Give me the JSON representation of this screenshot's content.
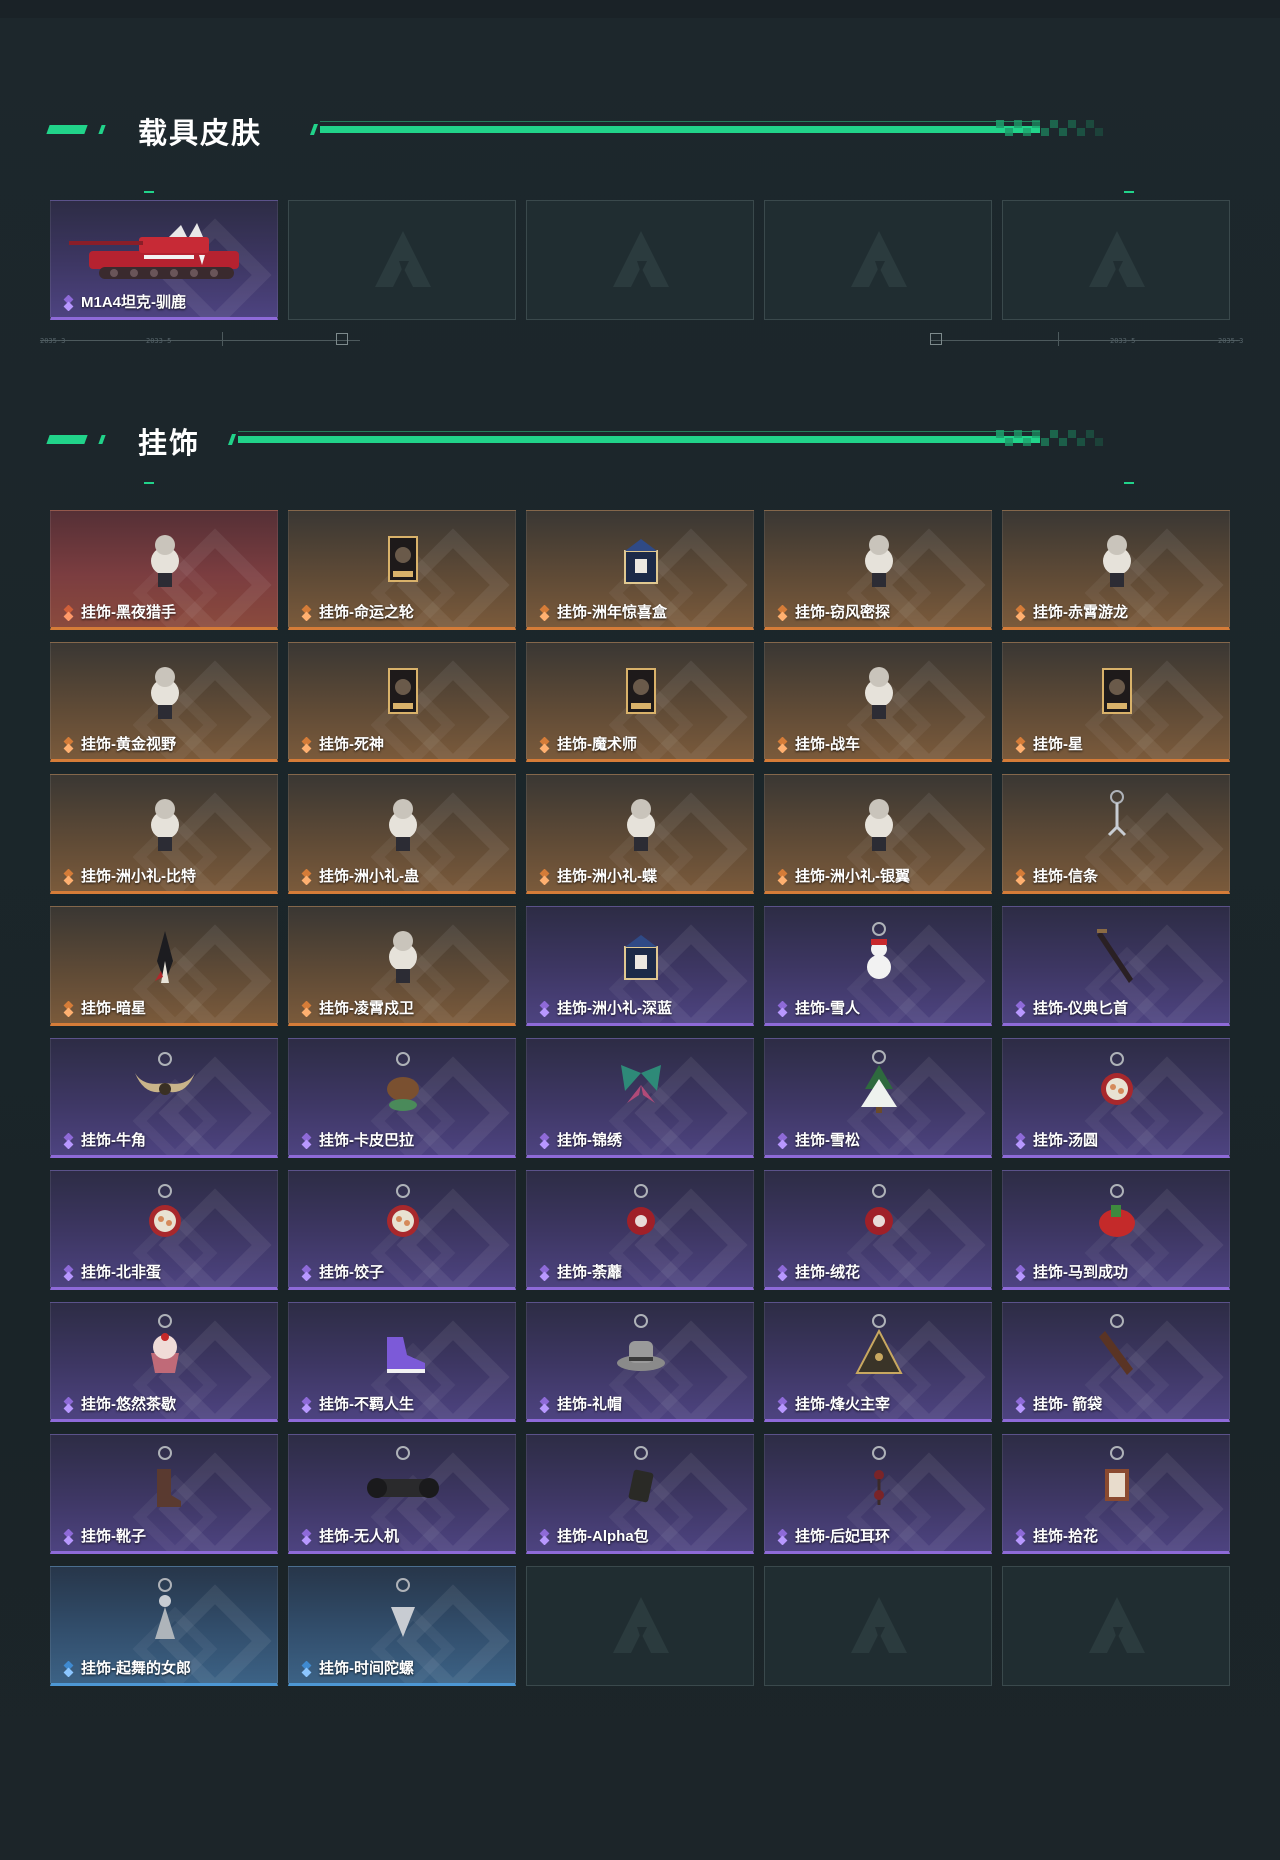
{
  "sections": {
    "vehicle_skins": {
      "title": "载具皮肤"
    },
    "pendants": {
      "title": "挂饰"
    }
  },
  "deco_labels": [
    "2035-3",
    "2033-5",
    "2033-5",
    "2035-3"
  ],
  "vehicle_cards": [
    {
      "label": "M1A4坦克-驯鹿",
      "rarity": "purple",
      "icon": "tank-icon"
    },
    {
      "label": "",
      "rarity": "empty",
      "icon": "placeholder-logo-icon"
    },
    {
      "label": "",
      "rarity": "empty",
      "icon": "placeholder-logo-icon"
    },
    {
      "label": "",
      "rarity": "empty",
      "icon": "placeholder-logo-icon"
    },
    {
      "label": "",
      "rarity": "empty",
      "icon": "placeholder-logo-icon"
    }
  ],
  "pendant_cards": [
    {
      "label": "挂饰-黑夜猎手",
      "rarity": "red",
      "icon": "pendant-figure-icon"
    },
    {
      "label": "挂饰-命运之轮",
      "rarity": "orange",
      "icon": "pendant-card-icon"
    },
    {
      "label": "挂饰-洲年惊喜盒",
      "rarity": "orange",
      "icon": "pendant-box-icon"
    },
    {
      "label": "挂饰-窃风密探",
      "rarity": "orange",
      "icon": "pendant-figure-icon"
    },
    {
      "label": "挂饰-赤霄游龙",
      "rarity": "orange",
      "icon": "pendant-figure-icon"
    },
    {
      "label": "挂饰-黄金视野",
      "rarity": "orange",
      "icon": "pendant-figure-icon"
    },
    {
      "label": "挂饰-死神",
      "rarity": "orange",
      "icon": "pendant-card-icon"
    },
    {
      "label": "挂饰-魔术师",
      "rarity": "orange",
      "icon": "pendant-card-icon"
    },
    {
      "label": "挂饰-战车",
      "rarity": "orange",
      "icon": "pendant-figure-icon"
    },
    {
      "label": "挂饰-星",
      "rarity": "orange",
      "icon": "pendant-card-icon"
    },
    {
      "label": "挂饰-洲小礼-比特",
      "rarity": "orange",
      "icon": "pendant-figure-icon"
    },
    {
      "label": "挂饰-洲小礼-蛊",
      "rarity": "orange",
      "icon": "pendant-figure-icon"
    },
    {
      "label": "挂饰-洲小礼-蝶",
      "rarity": "orange",
      "icon": "pendant-figure-icon"
    },
    {
      "label": "挂饰-洲小礼-银翼",
      "rarity": "orange",
      "icon": "pendant-figure-icon"
    },
    {
      "label": "挂饰-信条",
      "rarity": "orange",
      "icon": "pendant-charm-icon"
    },
    {
      "label": "挂饰-暗星",
      "rarity": "orange",
      "icon": "pendant-feather-icon"
    },
    {
      "label": "挂饰-凌霄戍卫",
      "rarity": "orange",
      "icon": "pendant-figure-icon"
    },
    {
      "label": "挂饰-洲小礼-深蓝",
      "rarity": "purple",
      "icon": "pendant-box-icon"
    },
    {
      "label": "挂饰-雪人",
      "rarity": "purple",
      "icon": "pendant-snowman-icon"
    },
    {
      "label": "挂饰-仪典匕首",
      "rarity": "purple",
      "icon": "pendant-dagger-icon"
    },
    {
      "label": "挂饰-牛角",
      "rarity": "purple",
      "icon": "pendant-horns-icon"
    },
    {
      "label": "挂饰-卡皮巴拉",
      "rarity": "purple",
      "icon": "pendant-capybara-icon"
    },
    {
      "label": "挂饰-锦绣",
      "rarity": "purple",
      "icon": "pendant-butterfly-icon"
    },
    {
      "label": "挂饰-雪松",
      "rarity": "purple",
      "icon": "pendant-tree-icon"
    },
    {
      "label": "挂饰-汤圆",
      "rarity": "purple",
      "icon": "pendant-bowl-icon"
    },
    {
      "label": "挂饰-北非蛋",
      "rarity": "purple",
      "icon": "pendant-bowl-icon"
    },
    {
      "label": "挂饰-饺子",
      "rarity": "purple",
      "icon": "pendant-bowl-icon"
    },
    {
      "label": "挂饰-荼蘼",
      "rarity": "purple",
      "icon": "pendant-flower-icon"
    },
    {
      "label": "挂饰-绒花",
      "rarity": "purple",
      "icon": "pendant-flower-icon"
    },
    {
      "label": "挂饰-马到成功",
      "rarity": "purple",
      "icon": "pendant-horse-icon"
    },
    {
      "label": "挂饰-悠然茶歇",
      "rarity": "purple",
      "icon": "pendant-cupcake-icon"
    },
    {
      "label": "挂饰-不羁人生",
      "rarity": "purple",
      "icon": "pendant-sneaker-icon"
    },
    {
      "label": "挂饰-礼帽",
      "rarity": "purple",
      "icon": "pendant-hat-icon"
    },
    {
      "label": "挂饰-烽火主宰",
      "rarity": "purple",
      "icon": "pendant-pyramid-icon"
    },
    {
      "label": "挂饰- 箭袋",
      "rarity": "purple",
      "icon": "pendant-quiver-icon"
    },
    {
      "label": "挂饰-靴子",
      "rarity": "purple",
      "icon": "pendant-boot-icon"
    },
    {
      "label": "挂饰-无人机",
      "rarity": "purple",
      "icon": "pendant-drone-icon"
    },
    {
      "label": "挂饰-Alpha包",
      "rarity": "purple",
      "icon": "pendant-bag-icon"
    },
    {
      "label": "挂饰-后妃耳环",
      "rarity": "purple",
      "icon": "pendant-earring-icon"
    },
    {
      "label": "挂饰-拾花",
      "rarity": "purple",
      "icon": "pendant-frame-icon"
    },
    {
      "label": "挂饰-起舞的女郎",
      "rarity": "blue",
      "icon": "pendant-dancer-icon"
    },
    {
      "label": "挂饰-时间陀螺",
      "rarity": "blue",
      "icon": "pendant-top-icon"
    },
    {
      "label": "",
      "rarity": "empty",
      "icon": "placeholder-logo-icon"
    },
    {
      "label": "",
      "rarity": "empty",
      "icon": "placeholder-logo-icon"
    },
    {
      "label": "",
      "rarity": "empty",
      "icon": "placeholder-logo-icon"
    }
  ],
  "colors": {
    "accent_green": "#21d38a",
    "rarity_red": "#8a4a3d",
    "rarity_orange": "#d57c38",
    "rarity_purple": "#8e6ad8",
    "rarity_blue": "#4d97d4"
  }
}
